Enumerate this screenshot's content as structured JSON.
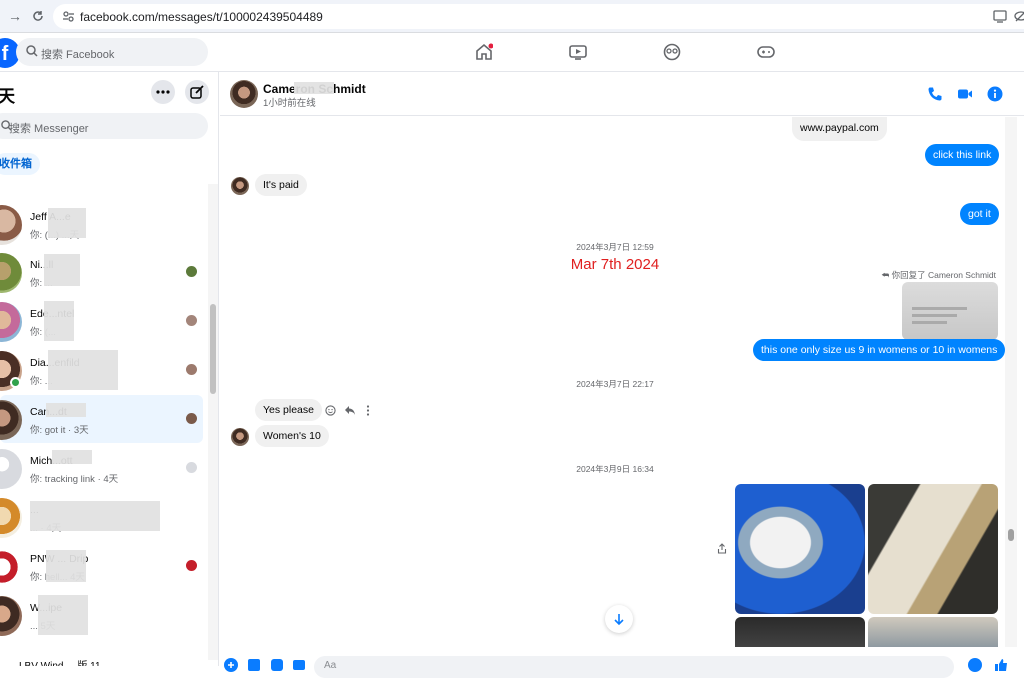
{
  "browser": {
    "url": "facebook.com/messages/t/100002439504489"
  },
  "facebook": {
    "logo": "f",
    "search_placeholder": "搜索 Facebook",
    "nav_icons": [
      "home-icon",
      "video-icon",
      "groups-icon",
      "gaming-icon"
    ]
  },
  "sidebar": {
    "title": "天",
    "search_placeholder": "搜索 Messenger",
    "inbox_tab": "收件箱",
    "conversations": [
      {
        "name": "Jeff A...e",
        "preview": "你: (...) ...天"
      },
      {
        "name": "Ni...ll",
        "preview": "你: ..."
      },
      {
        "name": "Ede...ntel",
        "preview": "你: (..."
      },
      {
        "name": "Dia...enfild",
        "preview": "你: ..."
      },
      {
        "name": "Can...dt",
        "preview": "你: got it · 3天"
      },
      {
        "name": "Mich...ott",
        "preview": "你: tracking link · 4天"
      },
      {
        "name": "...",
        "preview": "... · 4天"
      },
      {
        "name": "PNW ... Drip",
        "preview": "你: hell... 4天"
      },
      {
        "name": "W...ipe",
        "preview": "... 5天"
      }
    ],
    "bottom_text": "LBV Wind ... 版 11"
  },
  "chat": {
    "contact_name": "Cameron Schmidt",
    "contact_status": "1小时前在线",
    "messages": {
      "m1": "www.paypal.com",
      "m2": "click this link",
      "m3": "It's paid",
      "m4": "got it",
      "ts1": "2024年3月7日 12:59",
      "date_annotation": "Mar 7th 2024",
      "replied_to": "你回复了 Cameron Schmidt",
      "m5": "this one only size us 9 in womens or 10 in womens",
      "ts2": "2024年3月7日 22:17",
      "m6": "Yes please",
      "m7": "Women's 10",
      "ts3": "2024年3月9日 16:34"
    },
    "composer_placeholder": "Aa"
  },
  "colors": {
    "accent": "#0084ff",
    "annotation_red": "#e02020"
  }
}
